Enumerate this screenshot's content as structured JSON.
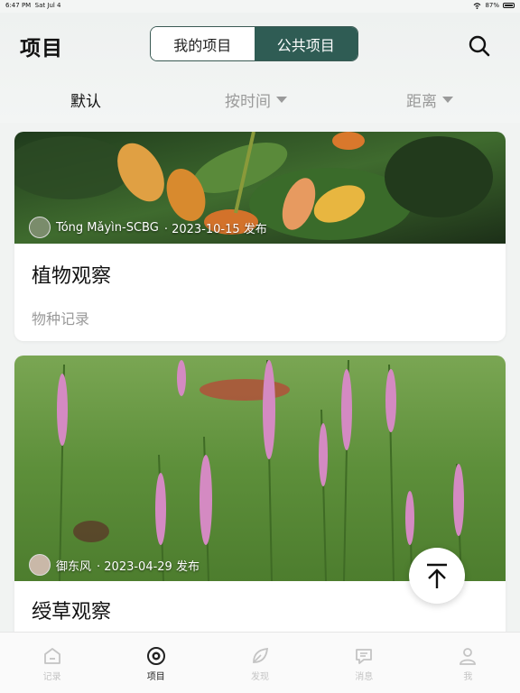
{
  "status_bar": {
    "time": "6:47 PM",
    "date": "Sat Jul 4",
    "battery": "87%"
  },
  "header": {
    "title": "项目",
    "segments": [
      "我的项目",
      "公共项目"
    ],
    "active_segment": 1,
    "filters": {
      "default": "默认",
      "by_time": "按时间",
      "distance": "距离"
    }
  },
  "cards": [
    {
      "author": "Tóng Mǎyìn-SCBG",
      "meta_suffix": " · 2023-10-15 发布",
      "title": "植物观察",
      "subtitle": "物种记录"
    },
    {
      "author": "御东风",
      "meta_suffix": " · 2023-04-29 发布",
      "title": "绶草观察"
    }
  ],
  "tabbar": {
    "items": [
      {
        "label": "记录",
        "icon": "home-icon"
      },
      {
        "label": "项目",
        "icon": "project-icon"
      },
      {
        "label": "发现",
        "icon": "leaf-icon"
      },
      {
        "label": "消息",
        "icon": "message-icon"
      },
      {
        "label": "我",
        "icon": "user-icon"
      }
    ],
    "active": 1
  },
  "colors": {
    "accent": "#2f5c54",
    "inactive": "#c4c4c4"
  }
}
